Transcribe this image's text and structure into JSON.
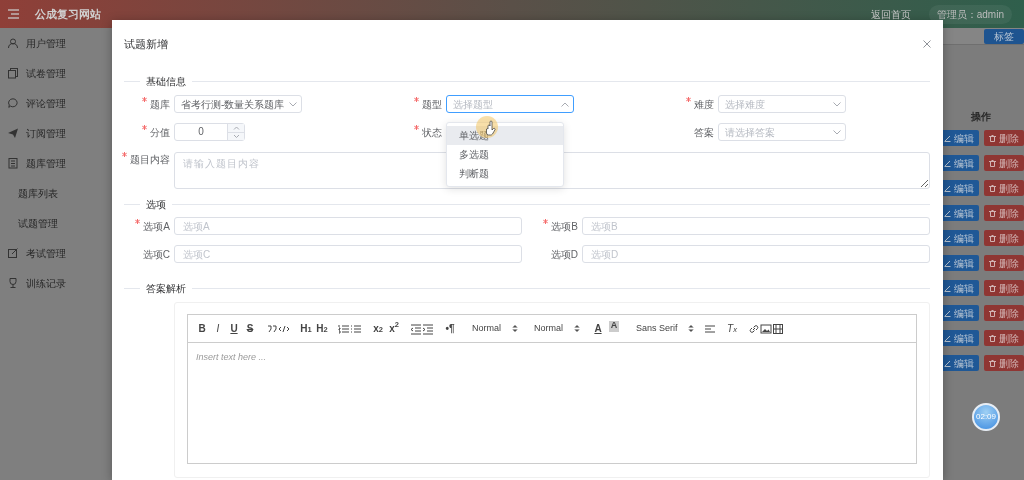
{
  "header": {
    "brand": "公成复习网站",
    "home_link": "返回首页",
    "user": "管理员：admin"
  },
  "sidebar": {
    "items": [
      {
        "label": "用户管理",
        "kind": "user"
      },
      {
        "label": "试卷管理",
        "kind": "papers"
      },
      {
        "label": "评论管理",
        "kind": "chat"
      },
      {
        "label": "订阅管理",
        "kind": "send"
      },
      {
        "label": "题库管理",
        "kind": "document",
        "children": [
          {
            "label": "题库列表"
          },
          {
            "label": "试题管理"
          }
        ]
      },
      {
        "label": "考试管理",
        "kind": "edit"
      },
      {
        "label": "训练记录",
        "kind": "trophy"
      }
    ]
  },
  "toolbar": {
    "tag_button": "标签"
  },
  "table": {
    "columns": [
      "操作"
    ],
    "rows": [
      {
        "edit": "编辑",
        "delete": "删除"
      },
      {
        "edit": "编辑",
        "delete": "删除"
      },
      {
        "edit": "编辑",
        "delete": "删除"
      },
      {
        "edit": "编辑",
        "delete": "删除"
      },
      {
        "edit": "编辑",
        "delete": "删除"
      },
      {
        "edit": "编辑",
        "delete": "删除"
      },
      {
        "edit": "编辑",
        "delete": "删除"
      },
      {
        "edit": "编辑",
        "delete": "删除"
      },
      {
        "edit": "编辑",
        "delete": "删除"
      },
      {
        "edit": "编辑",
        "delete": "删除"
      }
    ]
  },
  "modal": {
    "title": "试题新增",
    "basic": {
      "title": "基础信息",
      "fields": [
        {
          "label": "题库",
          "required": true,
          "kind": "select",
          "value": "省考行测-数量关系题库",
          "focused": false
        },
        {
          "label": "题型",
          "required": true,
          "kind": "select",
          "placeholder": "选择题型",
          "focused": true
        },
        {
          "label": "难度",
          "required": true,
          "kind": "select",
          "placeholder": "选择难度",
          "focused": false
        },
        {
          "label": "分值",
          "required": true,
          "kind": "number",
          "value": "0"
        },
        {
          "label": "状态",
          "required": true,
          "kind": "covered"
        },
        {
          "label": "答案",
          "required": false,
          "kind": "select",
          "placeholder": "请选择答案",
          "focused": false
        }
      ],
      "content": {
        "label": "题目内容",
        "required": true,
        "placeholder": "请输入题目内容"
      }
    },
    "dropdown": {
      "options": [
        {
          "label": "单选题",
          "hovered": true
        },
        {
          "label": "多选题",
          "hovered": false
        },
        {
          "label": "判断题",
          "hovered": false
        }
      ]
    },
    "options": {
      "title": "选项",
      "fields": [
        {
          "label": "选项A",
          "required": true,
          "placeholder": "选项A"
        },
        {
          "label": "选项B",
          "required": true,
          "placeholder": "选项B"
        },
        {
          "label": "选项C",
          "required": false,
          "placeholder": "选项C"
        },
        {
          "label": "选项D",
          "required": false,
          "placeholder": "选项D"
        }
      ]
    },
    "analysis": {
      "title": "答案解析",
      "editor": {
        "placeholder": "Insert text here ...",
        "toolbar": [
          [
            {
              "kind": "bold",
              "label": "B"
            },
            {
              "kind": "italic",
              "label": "I"
            },
            {
              "kind": "underline",
              "label": "U"
            },
            {
              "kind": "strike",
              "label": "S"
            }
          ],
          [
            {
              "kind": "quote"
            },
            {
              "kind": "code"
            }
          ],
          [
            {
              "kind": "header",
              "label": "H$_{1}$"
            },
            {
              "kind": "header",
              "label": "H$_{2}$"
            }
          ],
          [
            {
              "kind": "ordered-list"
            },
            {
              "kind": "bullet-list"
            }
          ],
          [
            {
              "kind": "script",
              "label": "x$_{2}$"
            },
            {
              "kind": "script",
              "label": "x$^{2}$"
            }
          ],
          [
            {
              "kind": "outdent"
            },
            {
              "kind": "indent"
            }
          ],
          [
            {
              "kind": "direction",
              "label": "•¶"
            }
          ],
          [
            {
              "kind": "picker",
              "label": "Normal"
            }
          ],
          [
            {
              "kind": "picker",
              "label": "Normal"
            }
          ],
          [
            {
              "kind": "color",
              "label": "A"
            },
            {
              "kind": "background",
              "label": "A"
            }
          ],
          [
            {
              "kind": "picker",
              "label": "Sans Serif"
            }
          ],
          [
            {
              "kind": "align"
            }
          ],
          [
            {
              "kind": "clean",
              "label": "T$_{x}$"
            }
          ],
          [
            {
              "kind": "link"
            },
            {
              "kind": "image"
            },
            {
              "kind": "video"
            }
          ]
        ]
      }
    }
  },
  "timer": "02:09"
}
